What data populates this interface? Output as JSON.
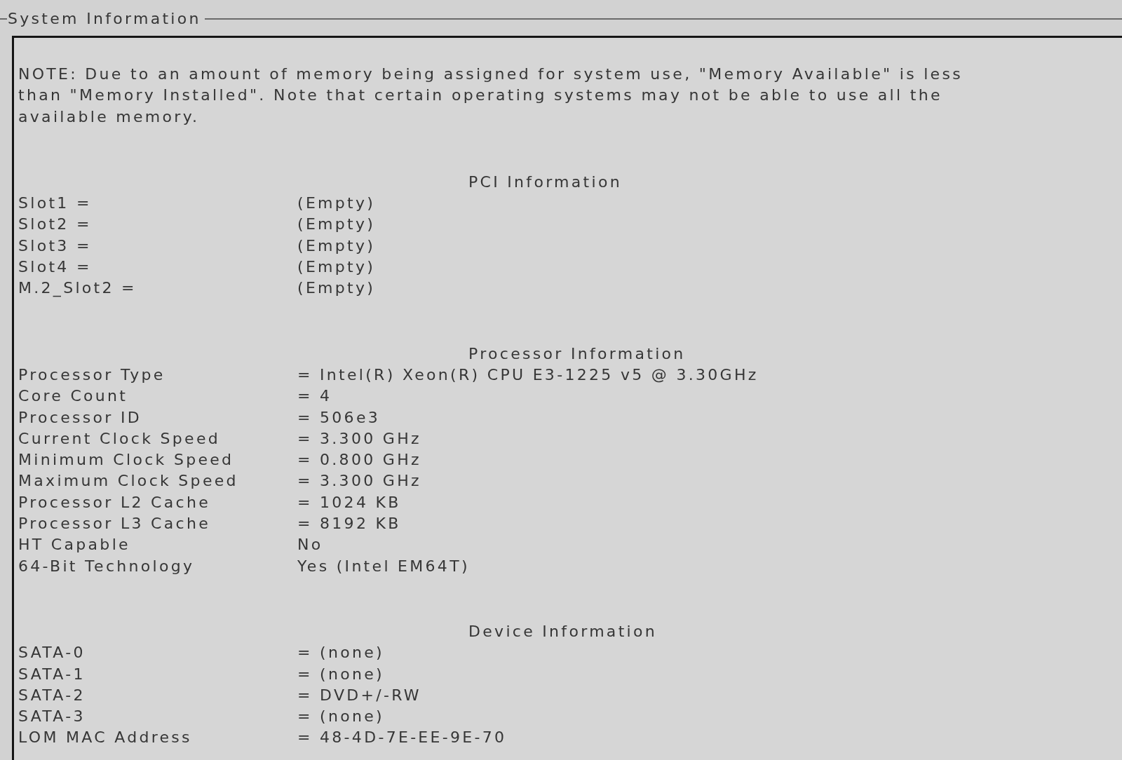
{
  "group_title": "System Information",
  "note": "NOTE: Due to an amount of memory being assigned for system use, \"Memory Available\" is less than \"Memory Installed\". Note that certain operating systems may not be able to use all the available memory.",
  "sections": [
    {
      "title": "PCI Information",
      "rows": [
        {
          "label": "Slot1 =",
          "value": "(Empty)"
        },
        {
          "label": "Slot2 =",
          "value": "(Empty)"
        },
        {
          "label": "Slot3 =",
          "value": "(Empty)"
        },
        {
          "label": "Slot4 =",
          "value": "(Empty)"
        },
        {
          "label": "M.2_Slot2 =",
          "value": "(Empty)"
        }
      ]
    },
    {
      "title": "Processor Information",
      "rows": [
        {
          "label": "Processor Type",
          "value": "= Intel(R) Xeon(R) CPU E3-1225 v5 @ 3.30GHz"
        },
        {
          "label": "Core Count",
          "value": "= 4"
        },
        {
          "label": "Processor ID",
          "value": "= 506e3"
        },
        {
          "label": "Current Clock Speed",
          "value": "= 3.300 GHz"
        },
        {
          "label": "Minimum Clock Speed",
          "value": "= 0.800 GHz"
        },
        {
          "label": "Maximum Clock Speed",
          "value": "= 3.300 GHz"
        },
        {
          "label": "Processor L2 Cache",
          "value": "= 1024 KB"
        },
        {
          "label": "Processor L3 Cache",
          "value": "= 8192 KB"
        },
        {
          "label": "HT Capable",
          "value": "No"
        },
        {
          "label": "64-Bit Technology",
          "value": "Yes (Intel EM64T)"
        }
      ]
    },
    {
      "title": "Device Information",
      "rows": [
        {
          "label": "SATA-0",
          "value": "= (none)"
        },
        {
          "label": "SATA-1",
          "value": "= (none)"
        },
        {
          "label": "SATA-2",
          "value": "= DVD+/-RW"
        },
        {
          "label": "SATA-3",
          "value": "= (none)"
        },
        {
          "label": "LOM MAC Address",
          "value": "= 48-4D-7E-EE-9E-70"
        }
      ]
    }
  ]
}
